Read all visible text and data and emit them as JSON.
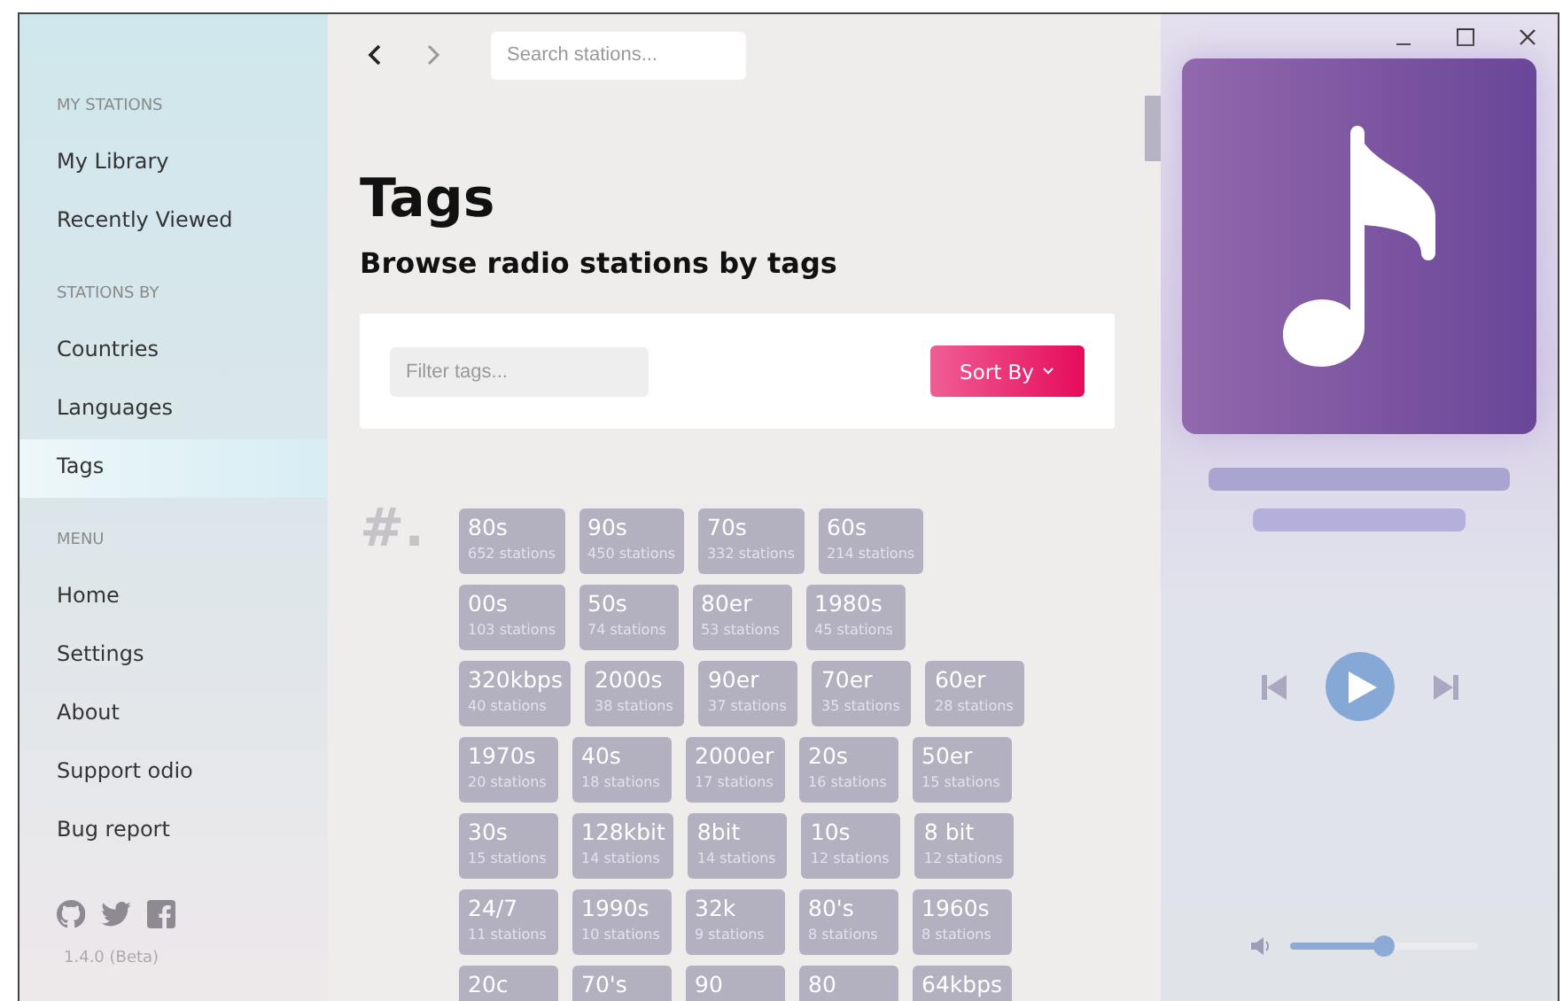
{
  "sidebar": {
    "sections": [
      {
        "heading": "MY STATIONS",
        "items": [
          {
            "label": "My Library",
            "selected": false
          },
          {
            "label": "Recently Viewed",
            "selected": false
          }
        ]
      },
      {
        "heading": "STATIONS BY",
        "items": [
          {
            "label": "Countries",
            "selected": false
          },
          {
            "label": "Languages",
            "selected": false
          },
          {
            "label": "Tags",
            "selected": true
          }
        ]
      },
      {
        "heading": "MENU",
        "items": [
          {
            "label": "Home",
            "selected": false
          },
          {
            "label": "Settings",
            "selected": false
          },
          {
            "label": "About",
            "selected": false
          },
          {
            "label": "Support odio",
            "selected": false
          },
          {
            "label": "Bug report",
            "selected": false
          }
        ]
      }
    ],
    "version": "1.4.0 (Beta)"
  },
  "search": {
    "placeholder": "Search stations..."
  },
  "page": {
    "title": "Tags",
    "subtitle": "Browse radio stations by tags"
  },
  "filter": {
    "placeholder": "Filter tags..."
  },
  "sort_button": "Sort By",
  "tag_group": {
    "heading": "#.",
    "rows": [
      [
        {
          "name": "80s",
          "count": "652 stations"
        },
        {
          "name": "90s",
          "count": "450 stations"
        },
        {
          "name": "70s",
          "count": "332 stations"
        },
        {
          "name": "60s",
          "count": "214 stations"
        }
      ],
      [
        {
          "name": "00s",
          "count": "103 stations"
        },
        {
          "name": "50s",
          "count": "74 stations"
        },
        {
          "name": "80er",
          "count": "53 stations"
        },
        {
          "name": "1980s",
          "count": "45 stations"
        }
      ],
      [
        {
          "name": "320kbps",
          "count": "40 stations"
        },
        {
          "name": "2000s",
          "count": "38 stations"
        },
        {
          "name": "90er",
          "count": "37 stations"
        },
        {
          "name": "70er",
          "count": "35 stations"
        },
        {
          "name": "60er",
          "count": "28 stations"
        }
      ],
      [
        {
          "name": "1970s",
          "count": "20 stations"
        },
        {
          "name": "40s",
          "count": "18 stations"
        },
        {
          "name": "2000er",
          "count": "17 stations"
        },
        {
          "name": "20s",
          "count": "16 stations"
        },
        {
          "name": "50er",
          "count": "15 stations"
        }
      ],
      [
        {
          "name": "30s",
          "count": "15 stations"
        },
        {
          "name": "128kbit",
          "count": "14 stations"
        },
        {
          "name": "8bit",
          "count": "14 stations"
        },
        {
          "name": "10s",
          "count": "12 stations"
        },
        {
          "name": "8 bit",
          "count": "12 stations"
        }
      ],
      [
        {
          "name": "24/7",
          "count": "11 stations"
        },
        {
          "name": "1990s",
          "count": "10 stations"
        },
        {
          "name": "32k",
          "count": "9 stations"
        },
        {
          "name": "80's",
          "count": "8 stations"
        },
        {
          "name": "1960s",
          "count": "8 stations"
        }
      ],
      [
        {
          "name": "20c"
        },
        {
          "name": "70's"
        },
        {
          "name": "90"
        },
        {
          "name": "80"
        },
        {
          "name": "64kbps"
        }
      ]
    ]
  },
  "player": {
    "volume": {
      "level": 0.5
    }
  }
}
